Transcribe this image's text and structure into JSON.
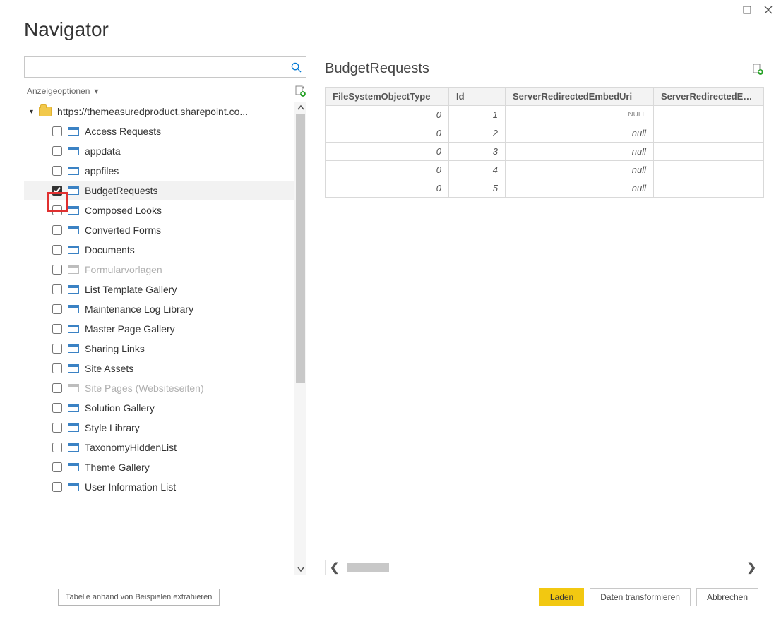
{
  "title": "Navigator",
  "search": {
    "placeholder": ""
  },
  "display_options_label": "Anzeigeoptionen",
  "root_label": "https://themeasuredproduct.sharepoint.co...",
  "tree_items": [
    {
      "label": "Access Requests",
      "checked": false,
      "dimmed": false
    },
    {
      "label": "appdata",
      "checked": false,
      "dimmed": false
    },
    {
      "label": "appfiles",
      "checked": false,
      "dimmed": false
    },
    {
      "label": "BudgetRequests",
      "checked": true,
      "dimmed": false
    },
    {
      "label": "Composed Looks",
      "checked": false,
      "dimmed": false
    },
    {
      "label": "Converted Forms",
      "checked": false,
      "dimmed": false
    },
    {
      "label": "Documents",
      "checked": false,
      "dimmed": false
    },
    {
      "label": "Formularvorlagen",
      "checked": false,
      "dimmed": true
    },
    {
      "label": "List Template Gallery",
      "checked": false,
      "dimmed": false
    },
    {
      "label": "Maintenance Log Library",
      "checked": false,
      "dimmed": false
    },
    {
      "label": "Master Page Gallery",
      "checked": false,
      "dimmed": false
    },
    {
      "label": "Sharing Links",
      "checked": false,
      "dimmed": false
    },
    {
      "label": "Site Assets",
      "checked": false,
      "dimmed": false
    },
    {
      "label": "Site Pages (Websiteseiten)",
      "checked": false,
      "dimmed": true
    },
    {
      "label": "Solution Gallery",
      "checked": false,
      "dimmed": false
    },
    {
      "label": "Style Library",
      "checked": false,
      "dimmed": false
    },
    {
      "label": "TaxonomyHiddenList",
      "checked": false,
      "dimmed": false
    },
    {
      "label": "Theme Gallery",
      "checked": false,
      "dimmed": false
    },
    {
      "label": "User Information List",
      "checked": false,
      "dimmed": false
    }
  ],
  "preview": {
    "title": "BudgetRequests",
    "columns": [
      "FileSystemObjectType",
      "Id",
      "ServerRedirectedEmbedUri",
      "ServerRedirectedEmbed"
    ],
    "rows": [
      [
        "0",
        "1",
        "NULL",
        ""
      ],
      [
        "0",
        "2",
        "null",
        ""
      ],
      [
        "0",
        "3",
        "null",
        ""
      ],
      [
        "0",
        "4",
        "null",
        ""
      ],
      [
        "0",
        "5",
        "null",
        ""
      ]
    ]
  },
  "footer": {
    "extract": "Tabelle anhand von Beispielen extrahieren",
    "load": "Laden",
    "transform": "Daten transformieren",
    "cancel": "Abbrechen"
  }
}
